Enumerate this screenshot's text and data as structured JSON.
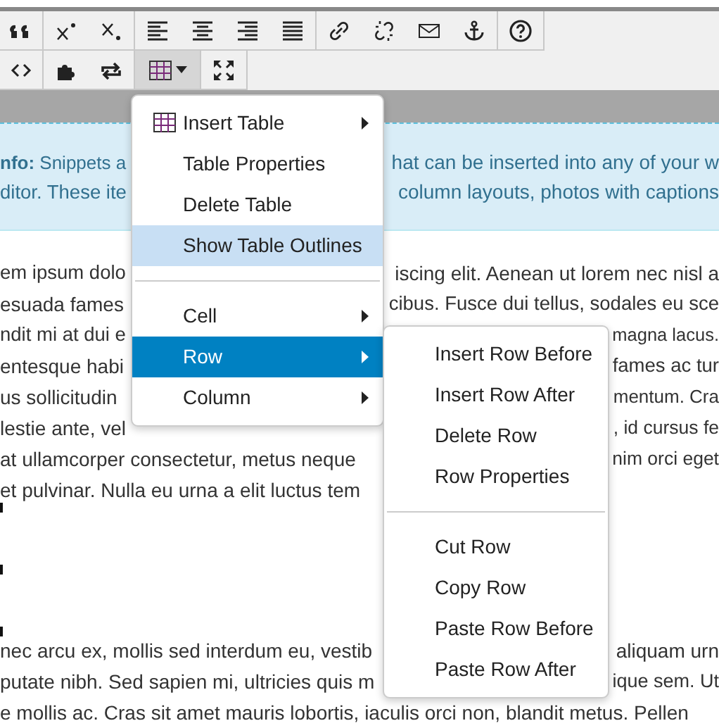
{
  "toolbar": {
    "rows": [
      [
        [
          {
            "kind": "quote",
            "pressed": false
          }
        ],
        [
          {
            "kind": "superscript",
            "pressed": false
          },
          {
            "kind": "subscript",
            "pressed": false
          }
        ],
        [
          {
            "kind": "align-left",
            "pressed": false
          },
          {
            "kind": "align-center",
            "pressed": false
          },
          {
            "kind": "align-right",
            "pressed": false
          },
          {
            "kind": "justify",
            "pressed": false
          }
        ],
        [
          {
            "kind": "link",
            "pressed": false
          },
          {
            "kind": "unlink",
            "pressed": false
          },
          {
            "kind": "mail",
            "pressed": false
          },
          {
            "kind": "anchor",
            "pressed": false
          }
        ],
        [
          {
            "kind": "help",
            "pressed": false
          }
        ]
      ],
      [
        [
          {
            "kind": "code",
            "pressed": false
          }
        ],
        [
          {
            "kind": "puzzle",
            "pressed": false
          },
          {
            "kind": "repeat",
            "pressed": false
          }
        ],
        [
          {
            "kind": "table",
            "pressed": true,
            "dropdown": true
          }
        ],
        [
          {
            "kind": "fullscreen",
            "pressed": false
          }
        ]
      ]
    ]
  },
  "info": {
    "lines": [
      {
        "left": "**nfo:** Snippets a",
        "right": "hat can be inserted into any of your w"
      },
      {
        "left": "ditor. These ite",
        "right": "column layouts, photos with captions"
      }
    ]
  },
  "paragraphs": [
    [
      {
        "left": "em ipsum dolo",
        "right": "iscing elit. Aenean ut lorem nec nisl a"
      },
      {
        "left": "esuada fames",
        "right": "cibus. Fusce dui tellus, sodales eu sce"
      },
      {
        "left": "ndit mi at dui e",
        "right": "magna lacus."
      },
      {
        "left": "entesque habi",
        "right": "fames ac tur"
      },
      {
        "left": "us sollicitudin",
        "right": "mentum. Cra"
      },
      {
        "left": "lestie ante, vel",
        "right": ", id cursus fe"
      },
      {
        "left": "at ullamcorper consectetur, metus neque",
        "right": "nim orci eget"
      },
      {
        "left": "et pulvinar. Nulla eu urna a elit luctus tem"
      }
    ],
    [
      {
        "left": "nec arcu ex, mollis sed interdum eu, vestib",
        "right": "aliquam urn"
      },
      {
        "left": "putate nibh. Sed sapien mi, ultricies quis m",
        "right": "ique sem. Ut"
      },
      {
        "left": "e mollis ac. Cras sit amet mauris lobortis, iaculis orci non, blandit metus. Pellen"
      }
    ]
  ],
  "table_menu": {
    "items": [
      {
        "kind": "table-item",
        "label": "Insert Table",
        "submenu": true,
        "highlighted": false,
        "selected": false
      },
      {
        "kind": "item",
        "label": "Table Properties",
        "submenu": false,
        "highlighted": false,
        "selected": false
      },
      {
        "kind": "item",
        "label": "Delete Table",
        "submenu": false,
        "highlighted": false,
        "selected": false
      },
      {
        "kind": "item",
        "label": "Show Table Outlines",
        "submenu": false,
        "highlighted": true,
        "selected": false
      },
      {
        "kind": "divider"
      },
      {
        "kind": "item",
        "label": "Cell",
        "submenu": true,
        "highlighted": false,
        "selected": false
      },
      {
        "kind": "item",
        "label": "Row",
        "submenu": true,
        "highlighted": false,
        "selected": true
      },
      {
        "kind": "item",
        "label": "Column",
        "submenu": true,
        "highlighted": false,
        "selected": false
      }
    ]
  },
  "row_menu": {
    "items": [
      {
        "kind": "item",
        "label": "Insert Row Before"
      },
      {
        "kind": "item",
        "label": "Insert Row After"
      },
      {
        "kind": "item",
        "label": "Delete Row"
      },
      {
        "kind": "item",
        "label": "Row Properties"
      },
      {
        "kind": "divider"
      },
      {
        "kind": "item",
        "label": "Cut Row"
      },
      {
        "kind": "item",
        "label": "Copy Row"
      },
      {
        "kind": "item",
        "label": "Paste Row Before"
      },
      {
        "kind": "item",
        "label": "Paste Row After"
      }
    ]
  }
}
